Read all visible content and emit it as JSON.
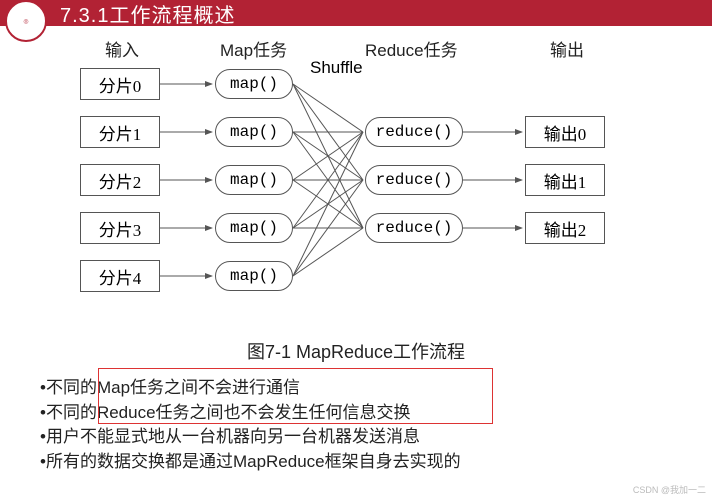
{
  "header": {
    "title": "7.3.1工作流程概述"
  },
  "cols": {
    "input": "输入",
    "map": "Map任务",
    "reduce": "Reduce任务",
    "output": "输出",
    "shuffle": "Shuffle"
  },
  "input_boxes": [
    "分片0",
    "分片1",
    "分片2",
    "分片3",
    "分片4"
  ],
  "map_ovals": [
    "map()",
    "map()",
    "map()",
    "map()",
    "map()"
  ],
  "reduce_ovals": [
    "reduce()",
    "reduce()",
    "reduce()"
  ],
  "output_boxes": [
    "输出0",
    "输出1",
    "输出2"
  ],
  "caption": "图7-1 MapReduce工作流程",
  "bullets": [
    "•不同的Map任务之间不会进行通信",
    "•不同的Reduce任务之间也不会发生任何信息交换",
    "•用户不能显式地从一台机器向另一台机器发送消息",
    "•所有的数据交换都是通过MapReduce框架自身去实现的"
  ],
  "watermark": "CSDN @我加一二"
}
